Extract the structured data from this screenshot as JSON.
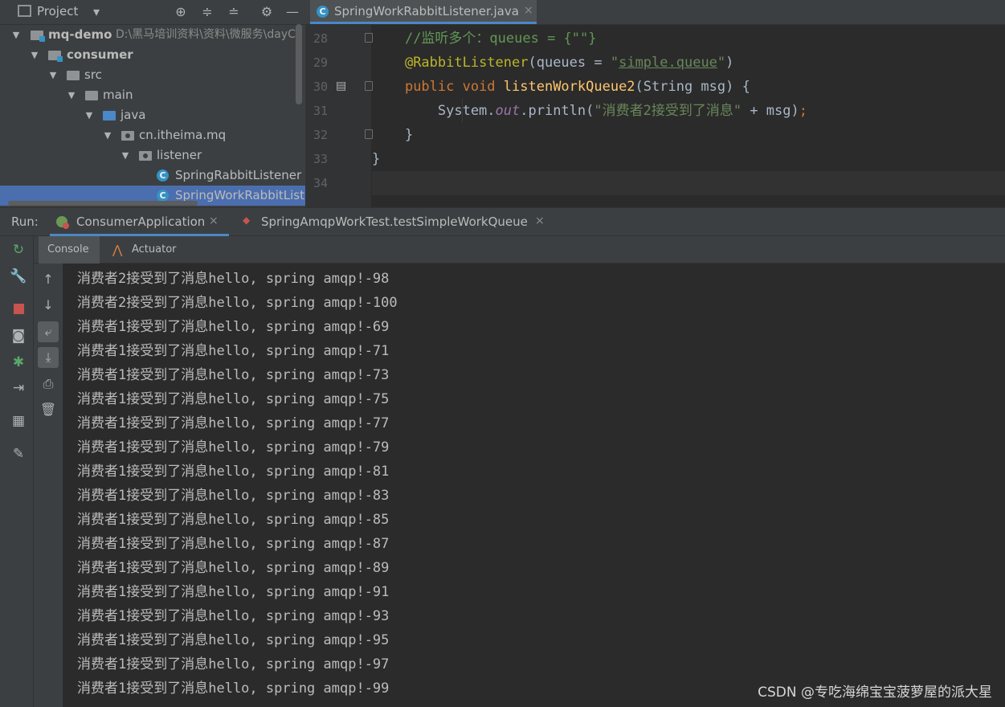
{
  "colors": {
    "panel_bg": "#3c3f41",
    "editor_bg": "#2b2b2b",
    "selection": "#4b6eaf",
    "accent_tab": "#4a88c7",
    "keyword": "#cc7832",
    "annotation": "#bbb529",
    "string": "#6a8759",
    "comment": "#629755",
    "function": "#ffc66d"
  },
  "project": {
    "title": "Project",
    "header_icons": [
      "chevron-down-icon",
      "crosshair-icon",
      "expand-all-icon",
      "collapse-all-icon",
      "gear-icon",
      "minimize-icon"
    ],
    "tree": [
      {
        "label": "mq-demo",
        "extra": "D:\\黑马培训资料\\资料\\微服务\\dayC",
        "icon": "module-folder-icon",
        "expanded": true
      },
      {
        "label": "consumer",
        "icon": "module-folder-icon",
        "expanded": true
      },
      {
        "label": "src",
        "icon": "folder-icon",
        "expanded": true
      },
      {
        "label": "main",
        "icon": "folder-icon",
        "expanded": true
      },
      {
        "label": "java",
        "icon": "source-folder-icon",
        "expanded": true
      },
      {
        "label": "cn.itheima.mq",
        "icon": "package-icon",
        "expanded": true
      },
      {
        "label": "listener",
        "icon": "package-icon",
        "expanded": true
      },
      {
        "label": "SpringRabbitListener",
        "icon": "class-icon"
      },
      {
        "label": "SpringWorkRabbitListe",
        "icon": "class-icon",
        "selected": true
      }
    ]
  },
  "editor": {
    "tab_label": "SpringWorkRabbitListener.java",
    "tab_close": "×",
    "lines": [
      {
        "num": "28",
        "parts": [
          [
            "plain",
            "    "
          ],
          [
            "comment",
            "//监听多个：queues = {\"\"}"
          ]
        ]
      },
      {
        "num": "29",
        "parts": [
          [
            "plain",
            "    "
          ],
          [
            "anno",
            "@RabbitListener"
          ],
          [
            "plain",
            "(queues = "
          ],
          [
            "str",
            "\""
          ],
          [
            "link",
            "simple.queue"
          ],
          [
            "str",
            "\""
          ],
          [
            "plain",
            ")"
          ]
        ]
      },
      {
        "num": "30",
        "parts": [
          [
            "plain",
            "    "
          ],
          [
            "kw",
            "public void "
          ],
          [
            "fn",
            "listenWorkQueue2"
          ],
          [
            "plain",
            "(String msg) {"
          ]
        ]
      },
      {
        "num": "31",
        "parts": [
          [
            "plain",
            "        System."
          ],
          [
            "static",
            "out"
          ],
          [
            "plain",
            ".println("
          ],
          [
            "str",
            "\"消费者2接受到了消息\""
          ],
          [
            "plain",
            " + msg)"
          ],
          [
            "kw",
            ";"
          ]
        ]
      },
      {
        "num": "32",
        "parts": [
          [
            "plain",
            "    }"
          ]
        ]
      },
      {
        "num": "33",
        "parts": [
          [
            "plain",
            "}"
          ]
        ]
      },
      {
        "num": "34",
        "parts": []
      }
    ]
  },
  "run": {
    "label": "Run:",
    "tabs": [
      {
        "label": "ConsumerApplication",
        "icon": "spring-boot-icon",
        "active": true,
        "close": "×"
      },
      {
        "label": "SpringAmqpWorkTest.testSimpleWorkQueue",
        "icon": "junit-icon",
        "active": false,
        "close": "×"
      }
    ],
    "console_tabs": [
      {
        "label": "Console",
        "active": true
      },
      {
        "label": "Actuator",
        "icon": "actuator-icon",
        "active": false
      }
    ],
    "left_toolbar": [
      "rerun-icon",
      "wrench-icon",
      "stop-icon",
      "camera-icon",
      "debug-icon",
      "exit-icon",
      "layout-icon",
      "pin-icon"
    ],
    "console_toolbar": [
      "arrow-up-icon",
      "arrow-down-icon",
      "soft-wrap-icon",
      "scroll-to-end-icon",
      "print-icon",
      "trash-icon"
    ],
    "output": [
      "消费者2接受到了消息hello, spring amqp!-98",
      "消费者2接受到了消息hello, spring amqp!-100",
      "消费者1接受到了消息hello, spring amqp!-69",
      "消费者1接受到了消息hello, spring amqp!-71",
      "消费者1接受到了消息hello, spring amqp!-73",
      "消费者1接受到了消息hello, spring amqp!-75",
      "消费者1接受到了消息hello, spring amqp!-77",
      "消费者1接受到了消息hello, spring amqp!-79",
      "消费者1接受到了消息hello, spring amqp!-81",
      "消费者1接受到了消息hello, spring amqp!-83",
      "消费者1接受到了消息hello, spring amqp!-85",
      "消费者1接受到了消息hello, spring amqp!-87",
      "消费者1接受到了消息hello, spring amqp!-89",
      "消费者1接受到了消息hello, spring amqp!-91",
      "消费者1接受到了消息hello, spring amqp!-93",
      "消费者1接受到了消息hello, spring amqp!-95",
      "消费者1接受到了消息hello, spring amqp!-97",
      "消费者1接受到了消息hello, spring amqp!-99"
    ]
  },
  "watermark": "CSDN @专吃海绵宝宝菠萝屋的派大星"
}
